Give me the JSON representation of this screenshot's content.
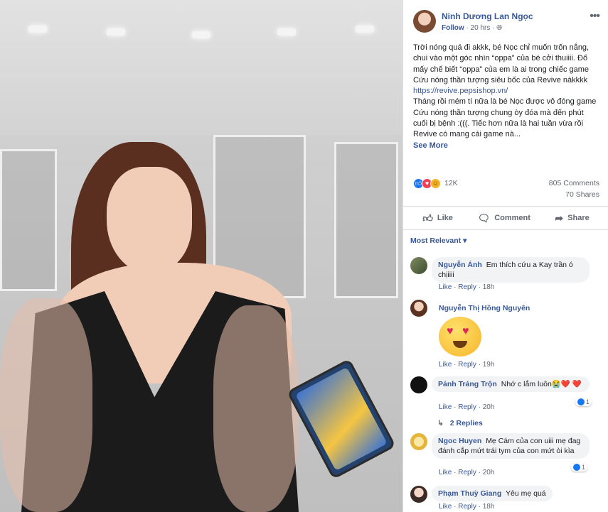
{
  "post": {
    "author": "Ninh Dương Lan Ngọc",
    "follow": "Follow",
    "time": "· 20 hrs ·",
    "globe_icon": "globe-icon",
    "more_icon": "ellipsis-icon",
    "text_before_link": "Trời nóng quá đi akkk, bé Nọc chỉ muốn trốn nắng, chui vào một góc nhìn “oppa” của bé cởi thuiiii. Đố mấy chế biết “oppa” của em là ai trong chiếc game Cứu nóng thần tượng siêu bốc của Revive nàkkkk ",
    "link": "https://revive.pepsishop.vn/",
    "text_after_link": "Tháng rồi mém tí nữa là bé Nọc được vô đóng game Cứu nóng thần tượng chung òy đóa mà đến phút cuối bị bệnh :(((. Tiếc hơn nữa là hai tuần vừa rồi Revive có mang cái game nà...",
    "see_more": "See More"
  },
  "stats": {
    "reaction_count": "12K",
    "comments": "805 Comments",
    "shares": "70 Shares",
    "reactions": [
      "like",
      "love",
      "haha"
    ]
  },
  "actions": {
    "like": "Like",
    "comment": "Comment",
    "share": "Share"
  },
  "sort": "Most Relevant",
  "comments": [
    {
      "name": "Nguyễn Ánh",
      "text": "Em thích cứu a Kay trần ó chịiiii",
      "like": "Like",
      "reply": "Reply",
      "time": "18h"
    },
    {
      "name": "Nguyễn Thị Hồng Nguyên",
      "text": "",
      "like": "Like",
      "reply": "Reply",
      "time": "19h"
    },
    {
      "name": "Pánh Tráng Trộn",
      "text": "Nhớ c lắm luôn😭❤️ ❤️",
      "like": "Like",
      "reply": "Reply",
      "time": "20h",
      "reactions": "1"
    },
    {
      "name": "Ngoc Huyen",
      "text": "Mẹ Cám của con uiii mẹ đag đánh cắp mứt trái tym của con mứt òi kìa",
      "like": "Like",
      "reply": "Reply",
      "time": "20h",
      "reactions": "1"
    },
    {
      "name": "Phạm Thuỳ Giang",
      "text": "Yêu mẹ quá",
      "like": "Like",
      "reply": "Reply",
      "time": "18h"
    }
  ],
  "replies_link": "2 Replies",
  "colors": {
    "link": "#385898",
    "muted": "#606770",
    "bubble": "#f2f3f5",
    "like_blue": "#1877f2"
  }
}
